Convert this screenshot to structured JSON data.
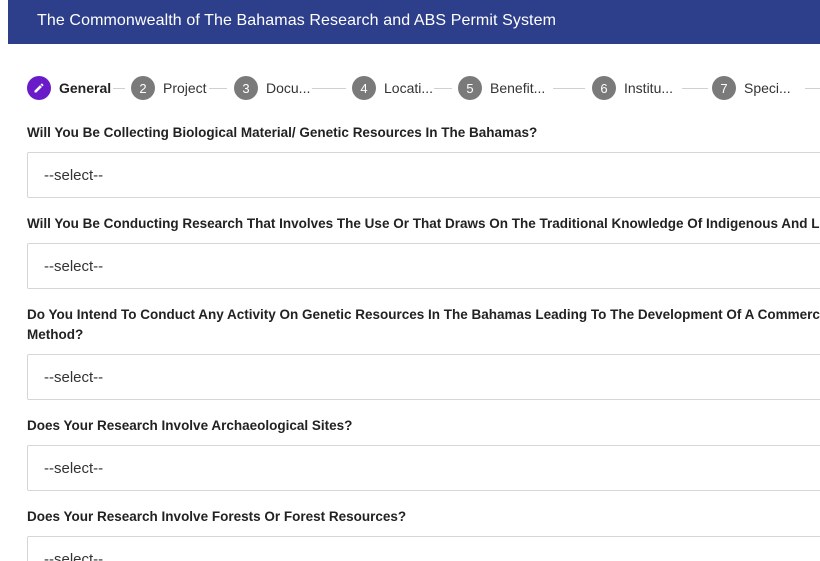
{
  "header": {
    "title": "The Commonwealth of The Bahamas Research and ABS Permit System"
  },
  "stepper": {
    "steps": [
      {
        "number": "",
        "label": "General",
        "active": true
      },
      {
        "number": "2",
        "label": "Project"
      },
      {
        "number": "3",
        "label": "Docu..."
      },
      {
        "number": "4",
        "label": "Locati..."
      },
      {
        "number": "5",
        "label": "Benefit..."
      },
      {
        "number": "6",
        "label": "Institu..."
      },
      {
        "number": "7",
        "label": "Speci..."
      }
    ]
  },
  "questions": [
    {
      "label": "Will You Be Collecting Biological Material/ Genetic Resources In The Bahamas?",
      "value": "--select--"
    },
    {
      "label": "Will You Be Conducting Research That Involves The Use Or That Draws On The Traditional Knowledge Of Indigenous And Local Communities?",
      "value": "--select--"
    },
    {
      "label": "Do You Intend To Conduct Any Activity On Genetic Resources In The Bahamas Leading To The Development Of A Commercial Product, Process Or Method?",
      "value": "--select--"
    },
    {
      "label": "Does Your Research Involve Archaeological Sites?",
      "value": "--select--"
    },
    {
      "label": "Does Your Research Involve Forests Or Forest Resources?",
      "value": "--select--"
    }
  ],
  "icons": {
    "edit": "pencil-icon"
  },
  "colors": {
    "header_bg": "#2d3e8a",
    "active_step": "#6a1bc9",
    "inactive_step": "#7a7a7a"
  }
}
